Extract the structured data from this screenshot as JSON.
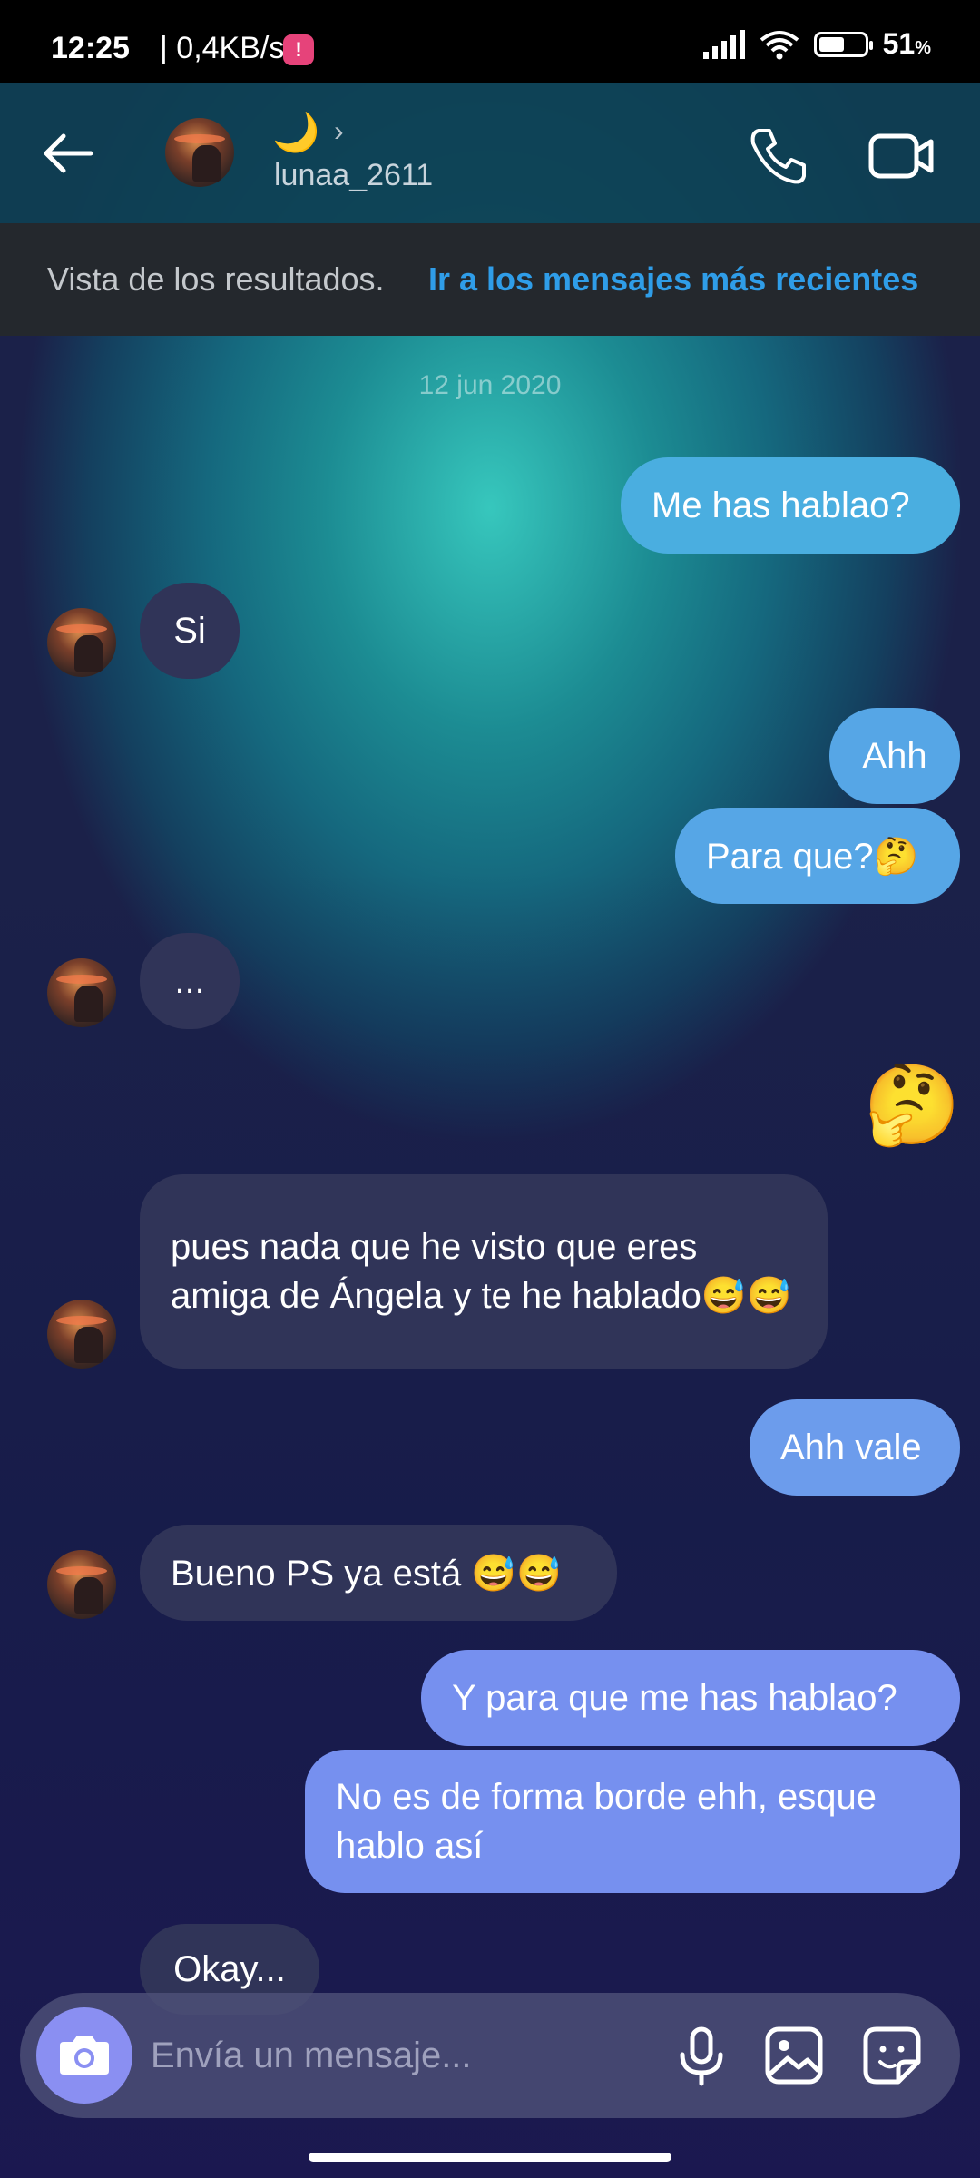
{
  "status_bar": {
    "time": "12:25",
    "speed": "| 0,4KB/s",
    "battery": "51",
    "battery_unit": "%"
  },
  "header": {
    "contact_emoji": "🌙",
    "contact_chevron": "›",
    "contact_username": "lunaa_2611"
  },
  "banner": {
    "text": "Vista de los resultados.",
    "link": "Ir a los mensajes más recientes"
  },
  "chat": {
    "date": "12 jun 2020",
    "messages": [
      {
        "from": "me",
        "text": "Me has hablao?"
      },
      {
        "from": "them",
        "text": "Si"
      },
      {
        "from": "me",
        "text": "Ahh"
      },
      {
        "from": "me",
        "text": "Para que?🤔"
      },
      {
        "from": "them",
        "text": "..."
      },
      {
        "from": "me",
        "text": "🤔"
      },
      {
        "from": "them",
        "text": "pues nada que he visto que eres amiga de Ángela y te he hablado😅😅"
      },
      {
        "from": "me",
        "text": "Ahh vale"
      },
      {
        "from": "them",
        "text": "Bueno PS ya está 😅😅"
      },
      {
        "from": "me",
        "text": "Y para que me has hablao?"
      },
      {
        "from": "me",
        "text": "No es de forma borde ehh, esque hablo así"
      },
      {
        "from": "them",
        "text": "Okay..."
      }
    ]
  },
  "composer": {
    "placeholder": "Envía un mensaje..."
  },
  "colors": {
    "link": "#2f9de8",
    "incoming_bubble": "#303458",
    "outgoing_bubble_top": "#4aaee0",
    "outgoing_bubble_bottom": "#7690ef"
  }
}
